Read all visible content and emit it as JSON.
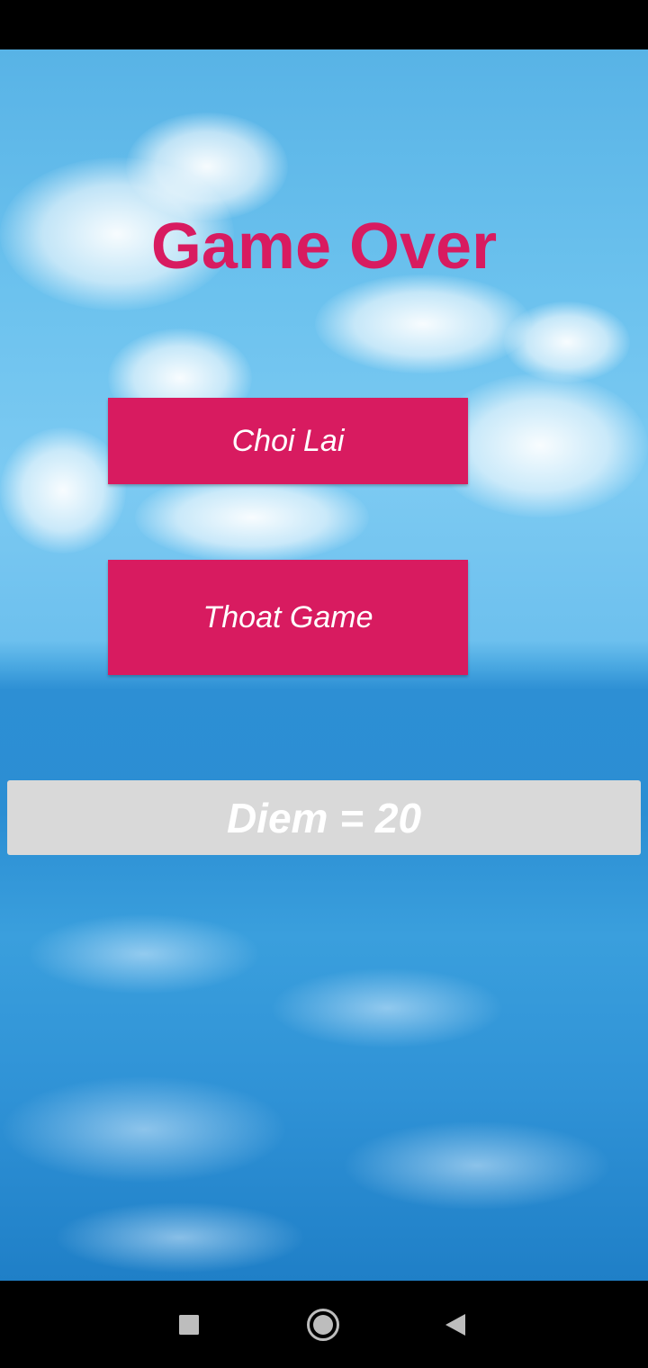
{
  "game": {
    "title": "Game Over",
    "replay_label": "Choi Lai",
    "exit_label": "Thoat Game",
    "score_text": "Diem = 20"
  },
  "colors": {
    "accent": "#d81b60",
    "score_bg": "#d9d9d9"
  },
  "nav": {
    "icons": [
      "square-recent-icon",
      "circle-home-icon",
      "triangle-back-icon"
    ]
  }
}
